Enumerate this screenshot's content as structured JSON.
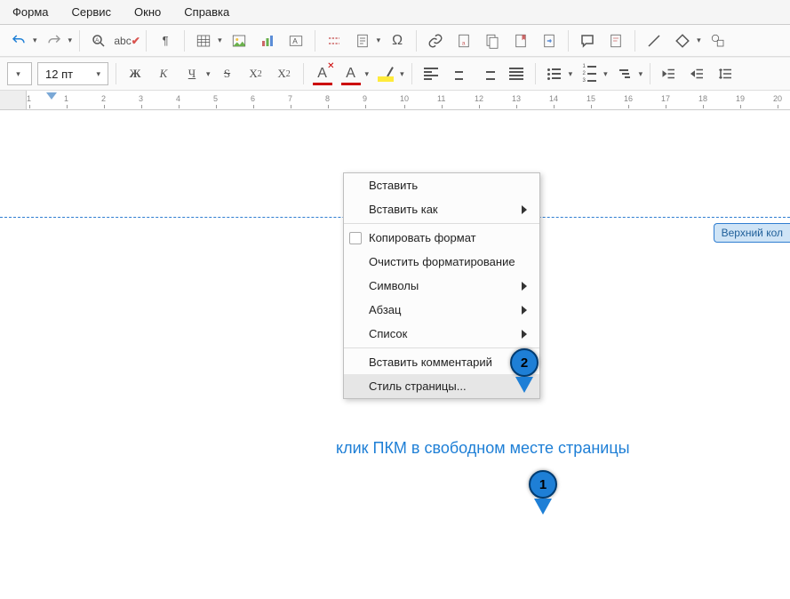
{
  "menubar": {
    "items": [
      "Форма",
      "Сервис",
      "Окно",
      "Справка"
    ]
  },
  "toolbar1": {
    "undo_tip": "Отменить",
    "redo_tip": "Повторить"
  },
  "toolbar2": {
    "font_size": "12 пт",
    "bold": "Ж",
    "italic": "К",
    "underline": "Ч",
    "strike": "S",
    "sup": "X",
    "sub": "X",
    "fontA": "A",
    "color_red": "#cc0000",
    "font_clear": "A"
  },
  "ruler": {
    "labels": [
      "1",
      "1",
      "2",
      "3",
      "4",
      "5",
      "6",
      "7",
      "8",
      "9",
      "10",
      "11",
      "12",
      "13",
      "14",
      "15",
      "16",
      "17",
      "18",
      "19",
      "20"
    ]
  },
  "page": {
    "header_tab": "Верхний кол",
    "annotation_text": "клик ПКМ в свободном месте страницы",
    "badge1": "1",
    "badge2": "2"
  },
  "context_menu": {
    "items": [
      {
        "label": "Вставить",
        "type": "item"
      },
      {
        "label": "Вставить как",
        "type": "sub"
      },
      {
        "type": "sep"
      },
      {
        "label": "Копировать формат",
        "type": "check"
      },
      {
        "label": "Очистить форматирование",
        "type": "item"
      },
      {
        "label": "Символы",
        "type": "sub"
      },
      {
        "label": "Абзац",
        "type": "sub"
      },
      {
        "label": "Список",
        "type": "sub"
      },
      {
        "type": "sep"
      },
      {
        "label": "Вставить комментарий",
        "type": "item"
      },
      {
        "label": "Стиль страницы...",
        "type": "item",
        "hover": true
      }
    ]
  }
}
